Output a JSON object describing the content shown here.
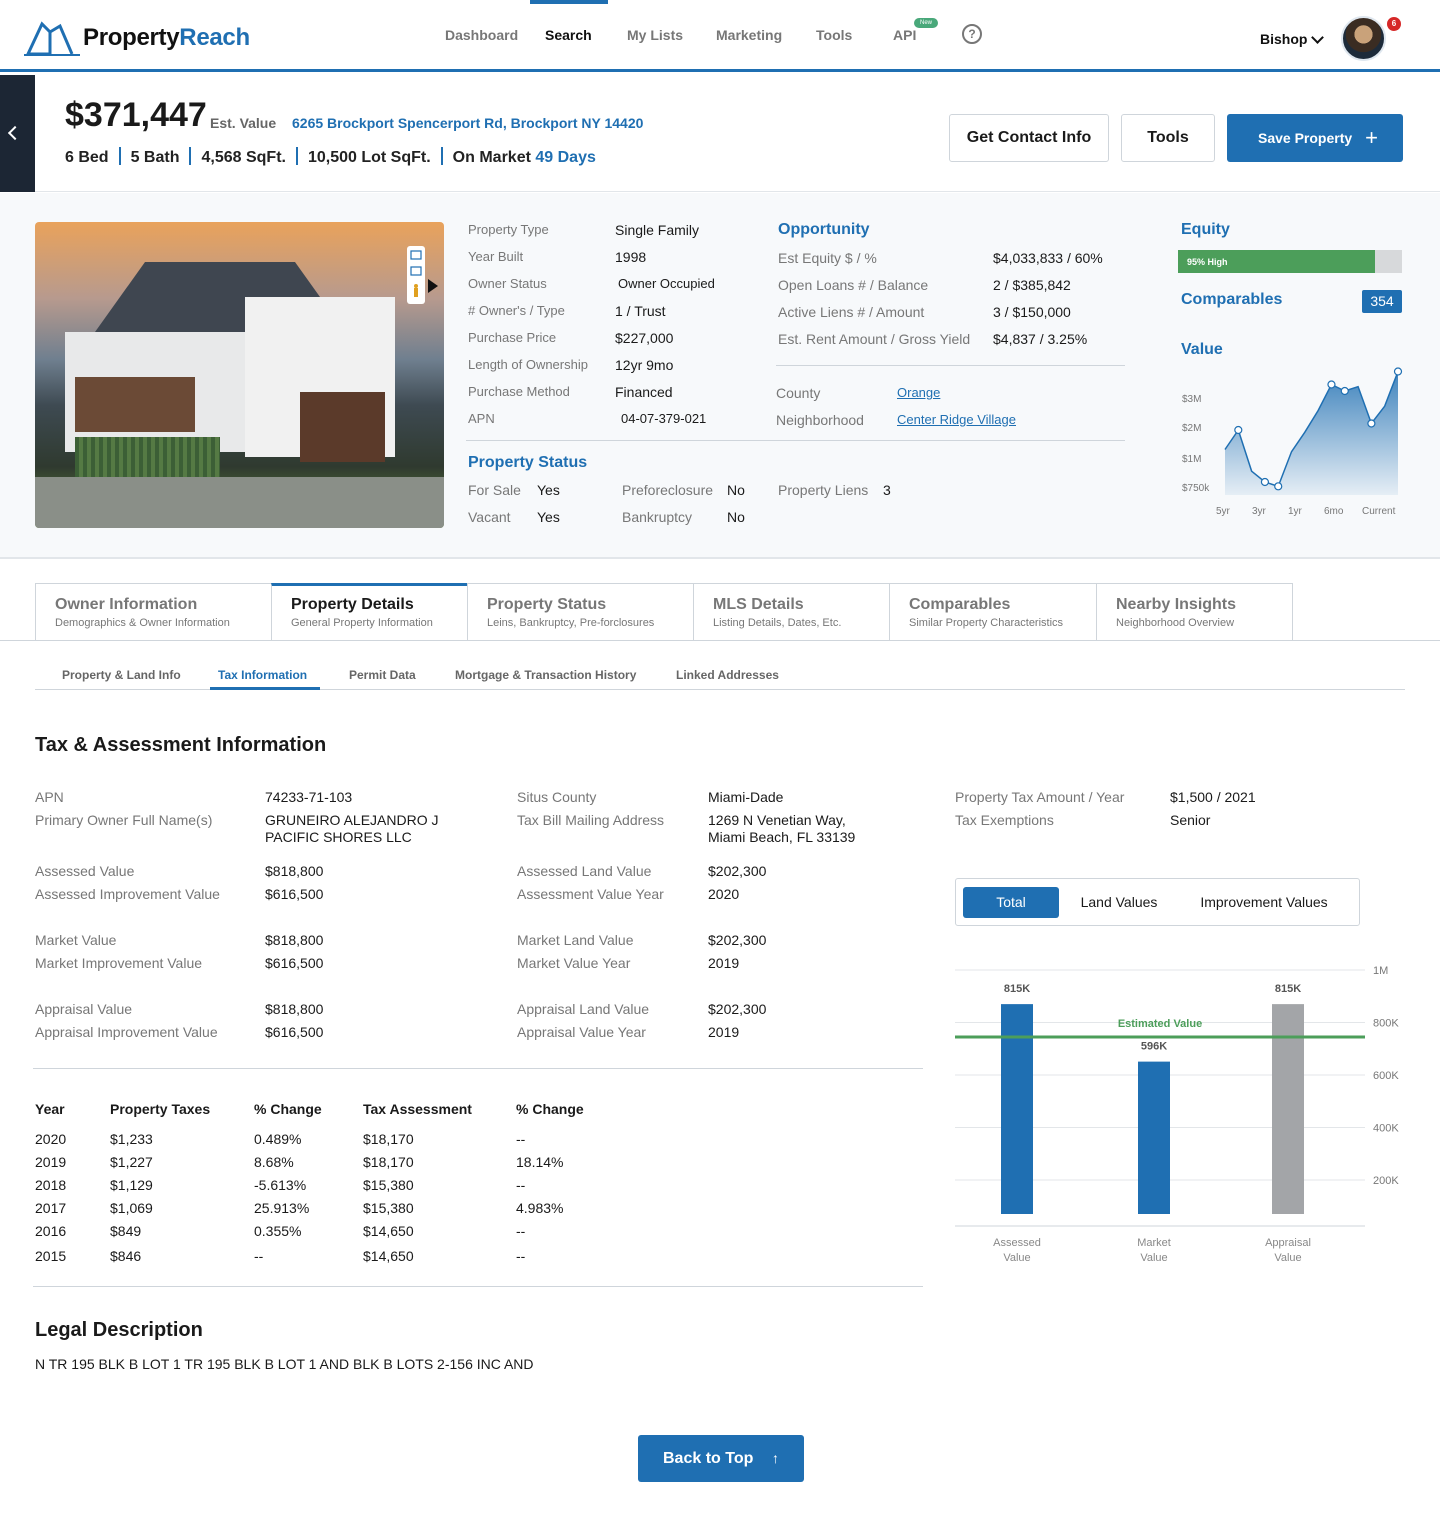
{
  "nav": {
    "logo_part1": "Property",
    "logo_part2": "Reach",
    "items": [
      "Dashboard",
      "Search",
      "My Lists",
      "Marketing",
      "Tools",
      "API"
    ],
    "new_badge": "New",
    "help": "?",
    "user": "Bishop",
    "notifications": "6"
  },
  "header": {
    "price": "$371,447",
    "est_label": "Est. Value",
    "address": "6265 Brockport Spencerport Rd, Brockport NY 14420",
    "beds": "6 Bed",
    "baths": "5 Bath",
    "sqft": "4,568 SqFt.",
    "lot": "10,500 Lot SqFt.",
    "on_market_label": "On Market",
    "on_market_days": "49 Days",
    "btn_contact": "Get Contact Info",
    "btn_tools": "Tools",
    "btn_save": "Save Property",
    "save_plus": "+"
  },
  "facts": [
    {
      "label": "Property Type",
      "value": "Single Family"
    },
    {
      "label": "Year Built",
      "value": "1998"
    },
    {
      "label": "Owner Status",
      "value": "Owner Occupied"
    },
    {
      "label": "# Owner's / Type",
      "value": "1 / Trust"
    },
    {
      "label": "Purchase Price",
      "value": "$227,000"
    },
    {
      "label": "Length of Ownership",
      "value": "12yr 9mo"
    },
    {
      "label": "Purchase Method",
      "value": "Financed"
    },
    {
      "label": "APN",
      "value": "04-07-379-021"
    }
  ],
  "opportunity": {
    "title": "Opportunity",
    "rows": [
      {
        "label": "Est Equity $ / %",
        "value": "$4,033,833 / 60%"
      },
      {
        "label": "Open Loans # / Balance",
        "value": "2 / $385,842"
      },
      {
        "label": "Active Liens # / Amount",
        "value": "3 / $150,000"
      },
      {
        "label": "Est. Rent Amount / Gross Yield",
        "value": "$4,837 / 3.25%"
      }
    ],
    "county_label": "County",
    "county": "Orange",
    "neighborhood_label": "Neighborhood",
    "neighborhood": "Center Ridge Village"
  },
  "status": {
    "title": "Property Status",
    "for_sale_label": "For Sale",
    "for_sale": "Yes",
    "vacant_label": "Vacant",
    "vacant": "Yes",
    "preforeclosure_label": "Preforeclosure",
    "preforeclosure": "No",
    "bankruptcy_label": "Bankruptcy",
    "bankruptcy": "No",
    "liens_label": "Property Liens",
    "liens": "3"
  },
  "equity": {
    "title": "Equity",
    "bar_label": "95% High",
    "fill_fraction": 0.88,
    "fill_color": "#4c9e5a",
    "comparables_label": "Comparables",
    "comparables_count": "354",
    "value_title": "Value"
  },
  "chart_data": [
    {
      "type": "area",
      "title": "Value",
      "x": [
        "5yr",
        "3yr",
        "1yr",
        "6mo",
        "Current"
      ],
      "y_tick_labels": [
        "$3M",
        "$2M",
        "$1M",
        "$750k"
      ],
      "series": [
        {
          "values": [
            1.6,
            2.05,
            1.1,
            0.85,
            0.75,
            1.55,
            2.0,
            2.5,
            3.1,
            2.95,
            3.05,
            2.2,
            2.6,
            3.4
          ]
        }
      ],
      "color": "#1f6fb2"
    },
    {
      "type": "bar",
      "categories": [
        "Assessed Value",
        "Market Value",
        "Appraisal Value"
      ],
      "values": [
        815000,
        596000,
        815000
      ],
      "data_labels": [
        "815K",
        "596K",
        "815K"
      ],
      "colors": [
        "#1f6fb2",
        "#1f6fb2",
        "#a3a5a8"
      ],
      "y_tick_labels": [
        "1M",
        "800K",
        "600K",
        "400K",
        "200K"
      ],
      "ylim": [
        0,
        1000000
      ],
      "reference_line": {
        "label": "Estimated Value",
        "value": 690000,
        "color": "#4c9e5a"
      },
      "toggle": [
        "Total",
        "Land Values",
        "Improvement Values"
      ]
    }
  ],
  "tabs": [
    {
      "title": "Owner Information",
      "sub": "Demographics & Owner Information"
    },
    {
      "title": "Property Details",
      "sub": "General Property Information"
    },
    {
      "title": "Property Status",
      "sub": "Leins, Bankruptcy, Pre-forclosures"
    },
    {
      "title": "MLS Details",
      "sub": "Listing Details, Dates, Etc."
    },
    {
      "title": "Comparables",
      "sub": "Similar Property Characteristics"
    },
    {
      "title": "Nearby Insights",
      "sub": "Neighborhood Overview"
    }
  ],
  "subtabs": [
    "Property & Land Info",
    "Tax Information",
    "Permit Data",
    "Mortgage & Transaction History",
    "Linked Addresses"
  ],
  "tax": {
    "title": "Tax & Assessment Information",
    "col1": [
      {
        "label": "APN",
        "value": "74233-71-103"
      },
      {
        "label": "Primary Owner Full Name(s)",
        "value": "GRUNEIRO ALEJANDRO J",
        "value2": "PACIFIC SHORES LLC"
      },
      {
        "label": "Assessed Value",
        "value": "$818,800"
      },
      {
        "label": "Assessed Improvement Value",
        "value": "$616,500"
      },
      {
        "label": "Market Value",
        "value": "$818,800"
      },
      {
        "label": "Market Improvement Value",
        "value": "$616,500"
      },
      {
        "label": "Appraisal Value",
        "value": "$818,800"
      },
      {
        "label": "Appraisal Improvement Value",
        "value": "$616,500"
      }
    ],
    "col2": [
      {
        "label": "Situs County",
        "value": "Miami-Dade"
      },
      {
        "label": "Tax Bill Mailing Address",
        "value": "1269 N Venetian Way,",
        "value2": "Miami Beach, FL 33139"
      },
      {
        "label": "Assessed Land Value",
        "value": "$202,300"
      },
      {
        "label": "Assessment Value Year",
        "value": "2020"
      },
      {
        "label": "Market Land Value",
        "value": "$202,300"
      },
      {
        "label": "Market Value Year",
        "value": "2019"
      },
      {
        "label": "Appraisal Land Value",
        "value": "$202,300"
      },
      {
        "label": "Appraisal Value Year",
        "value": "2019"
      }
    ],
    "col3": [
      {
        "label": "Property Tax Amount / Year",
        "value": "$1,500 / 2021"
      },
      {
        "label": "Tax Exemptions",
        "value": "Senior"
      }
    ],
    "table_headers": [
      "Year",
      "Property Taxes",
      "% Change",
      "Tax Assessment",
      "% Change"
    ],
    "table_rows": [
      [
        "2020",
        "$1,233",
        "0.489%",
        "$18,170",
        "--"
      ],
      [
        "2019",
        "$1,227",
        "8.68%",
        "$18,170",
        "18.14%"
      ],
      [
        "2018",
        "$1,129",
        "-5.613%",
        "$15,380",
        "--"
      ],
      [
        "2017",
        "$1,069",
        "25.913%",
        "$15,380",
        "4.983%"
      ],
      [
        "2016",
        "$849",
        "0.355%",
        "$14,650",
        "--"
      ],
      [
        "2015",
        "$846",
        "--",
        "$14,650",
        "--"
      ]
    ]
  },
  "legal": {
    "title": "Legal Description",
    "text": "N TR 195 BLK B LOT 1 TR 195 BLK B LOT 1 AND BLK B LOTS 2-156 INC AND"
  },
  "back_to_top": "Back to Top",
  "back_to_top_arrow": "↑"
}
